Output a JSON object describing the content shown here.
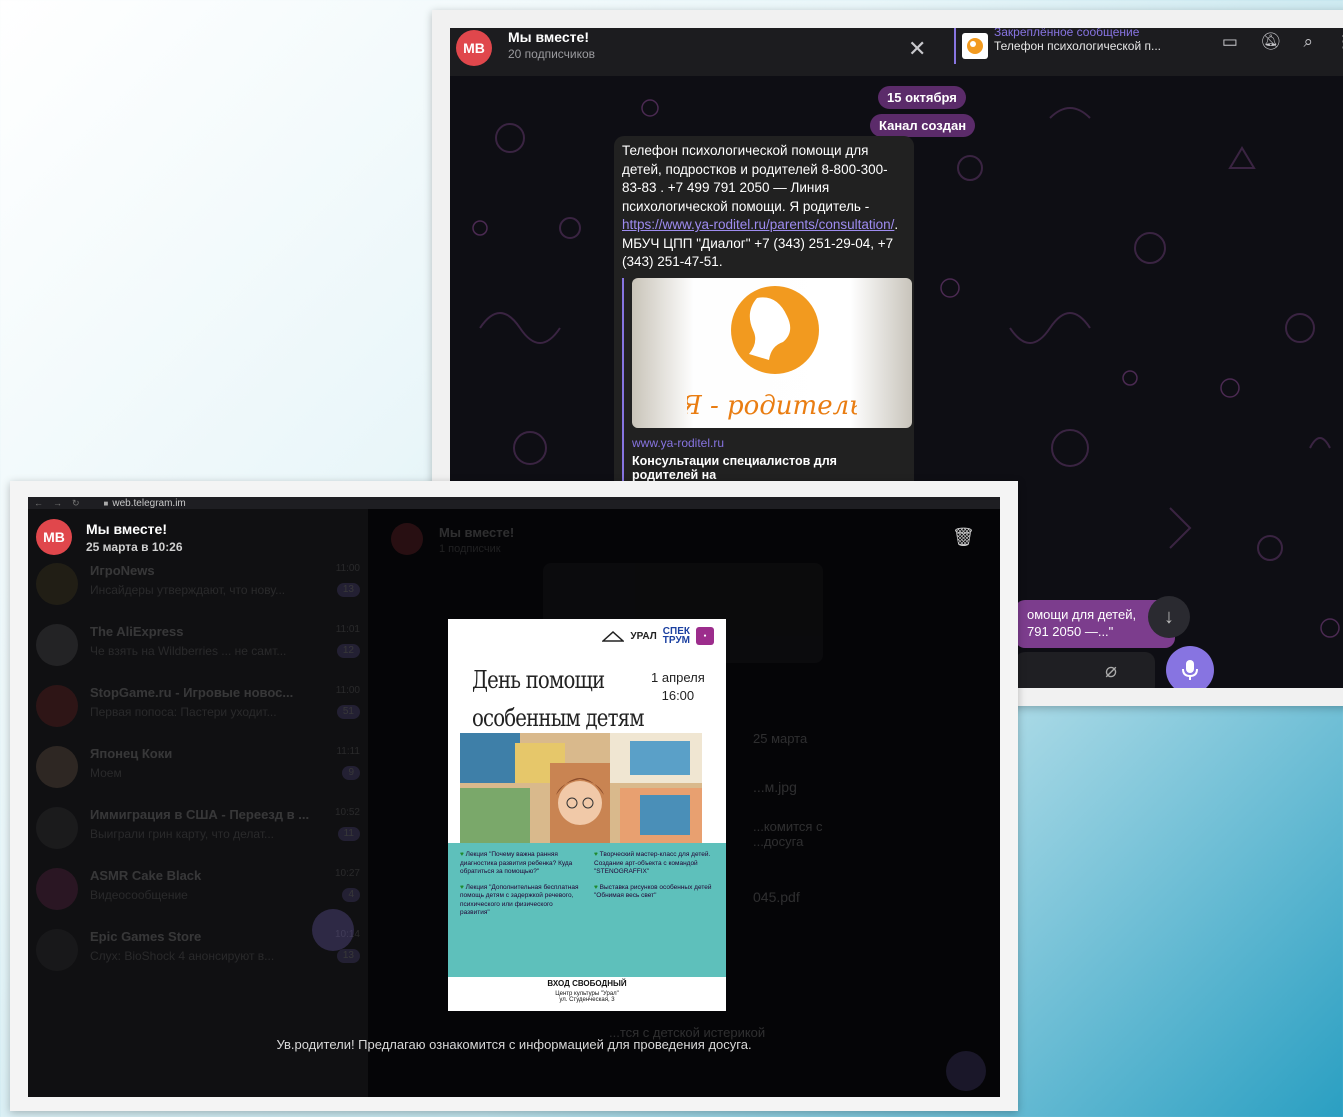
{
  "top_screenshot": {
    "header": {
      "avatar_initials": "МВ",
      "title": "Мы вместе!",
      "subtitle": "20 подписчиков",
      "close_icon": "close-icon",
      "pinned_label": "Закреплённое сообщение",
      "pinned_text": "Телефон психологической п...",
      "icons": [
        "chat-icon",
        "bell-off-icon",
        "search-icon",
        "more-icon"
      ]
    },
    "date_pill": "15 октября",
    "service_pill": "Канал создан",
    "message": {
      "text_before_link": "Телефон психологической помощи для детей, подростков и родителей 8-800-300-83-83 . +7 499 791 2050 — Линия психологической помощи. Я родитель - ",
      "link": "https://www.ya-roditel.ru/parents/consultation/",
      "text_after_link": ". МБУЧ ЦПП \"Диалог\" +7 (343) 251-29-04, +7 (343) 251-47-51.",
      "preview_logo_text": "Я - родитель",
      "preview_site": "www.ya-roditel.ru",
      "preview_description": "Консультации специалистов для родителей на"
    },
    "side_bubble_line1": "омощи для детей,",
    "side_bubble_line2": "791 2050 —...\""
  },
  "bottom_screenshot": {
    "url": "web.telegram.im",
    "viewer": {
      "avatar_initials": "МВ",
      "channel": "Мы вместе!",
      "date": "25 марта в 10:26"
    },
    "chats": [
      {
        "name": "ИгроNews",
        "preview": "Инсайдеры утверждают, что нову...",
        "time": "11:00",
        "badge": "13",
        "color": "#7a6a2a"
      },
      {
        "name": "The AliExpress",
        "preview": "Че взять на Wildberries ... не самт...",
        "time": "11:01",
        "badge": "12",
        "color": "#888888"
      },
      {
        "name": "StopGame.ru - Игровые новос...",
        "preview": "Первая попоса: Пастери уходит...",
        "time": "11:00",
        "badge": "51",
        "color": "#c8342c"
      },
      {
        "name": "Японец Коки",
        "preview": "Моем",
        "time": "11:11",
        "badge": "9",
        "color": "#c9a27a"
      },
      {
        "name": "Иммиграция в США - Переезд в ...",
        "preview": "Выиграли грин карту, что делат...",
        "time": "10:52",
        "badge": "11",
        "color": "#555555"
      },
      {
        "name": "ASMR Cake Black",
        "preview": "Видеосообщение",
        "time": "10:27",
        "badge": "4",
        "color": "#b0397a"
      },
      {
        "name": "Epic Games Store",
        "preview": "Слух: BioShock 4 анонсируют в...",
        "time": "10:14",
        "badge": "13",
        "color": "#444444"
      }
    ],
    "bg_chat_fragments": {
      "header_title": "Мы вместе!",
      "header_sub": "1 подписчик",
      "date": "25 марта",
      "file1": "...м.jpg",
      "file2": "045.pdf",
      "text1": "...комится с\n...досуга",
      "bottom": "...тся с детской истерикой"
    },
    "poster": {
      "logo_ural": "УРАЛ",
      "logo_spek": "СПЕК\nТРУМ",
      "title_line1": "День помощи",
      "title_line2": "особенным детям",
      "date": "1 апреля",
      "time": "16:00",
      "item1": "Лекция \"Почему важна ранняя диагностика развития ребенка? Куда обратиться за помощью?\"",
      "item2": "Лекция \"Дополнительная бесплатная помощь детям с задержкой речевого, психического или физического развития\"",
      "item3": "Творческий мастер-класс для детей. Создание арт-объекта с командой \"STENOGRAFFIX\"",
      "item4": "Выставка рисунков особенных детей \"Обнимая весь свет\"",
      "free_entry": "ВХОД СВОБОДНЫЙ",
      "venue": "Центр культуры \"Урал\"",
      "address": "ул. Студенческая, 3"
    },
    "caption": "Ув.родители! Предлагаю ознакомится с информацией для проведения досуга."
  }
}
